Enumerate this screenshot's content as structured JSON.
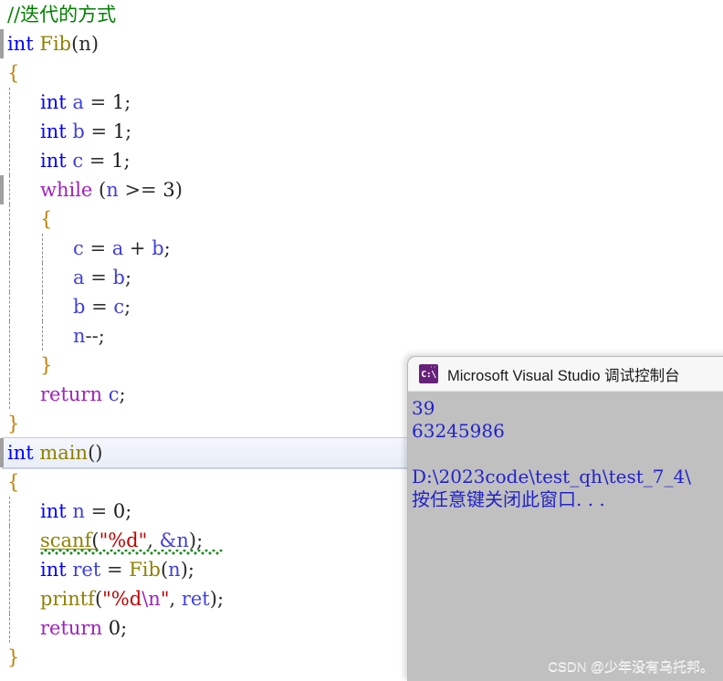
{
  "editor": {
    "name": "visual-studio-code-editor",
    "line_height": 32,
    "lines": [
      {
        "indent": 0,
        "changebar": false,
        "guides": 0,
        "tokens": [
          {
            "t": "//迭代的方式",
            "c": "cmt"
          }
        ]
      },
      {
        "indent": 0,
        "changebar": true,
        "guides": 0,
        "tokens": [
          {
            "t": "int",
            "c": "kw"
          },
          {
            "t": " ",
            "c": "plain"
          },
          {
            "t": "Fib",
            "c": "fn"
          },
          {
            "t": "(n)",
            "c": "punct"
          }
        ]
      },
      {
        "indent": 0,
        "changebar": false,
        "guides": 0,
        "tokens": [
          {
            "t": "{",
            "c": "brace"
          }
        ]
      },
      {
        "indent": 1,
        "changebar": false,
        "guides": 1,
        "tokens": [
          {
            "t": "int",
            "c": "kw"
          },
          {
            "t": " ",
            "c": "plain"
          },
          {
            "t": "a",
            "c": "var"
          },
          {
            "t": " = ",
            "c": "plain"
          },
          {
            "t": "1",
            "c": "num"
          },
          {
            "t": ";",
            "c": "punct"
          }
        ]
      },
      {
        "indent": 1,
        "changebar": false,
        "guides": 1,
        "tokens": [
          {
            "t": "int",
            "c": "kw"
          },
          {
            "t": " ",
            "c": "plain"
          },
          {
            "t": "b",
            "c": "var"
          },
          {
            "t": " = ",
            "c": "plain"
          },
          {
            "t": "1",
            "c": "num"
          },
          {
            "t": ";",
            "c": "punct"
          }
        ]
      },
      {
        "indent": 1,
        "changebar": false,
        "guides": 1,
        "tokens": [
          {
            "t": "int",
            "c": "kw"
          },
          {
            "t": " ",
            "c": "plain"
          },
          {
            "t": "c",
            "c": "var"
          },
          {
            "t": " = ",
            "c": "plain"
          },
          {
            "t": "1",
            "c": "num"
          },
          {
            "t": ";",
            "c": "punct"
          }
        ]
      },
      {
        "indent": 1,
        "changebar": true,
        "guides": 1,
        "tokens": [
          {
            "t": "while",
            "c": "kwc"
          },
          {
            "t": " (",
            "c": "punct"
          },
          {
            "t": "n",
            "c": "var"
          },
          {
            "t": " >= ",
            "c": "plain"
          },
          {
            "t": "3",
            "c": "num"
          },
          {
            "t": ")",
            "c": "punct"
          }
        ]
      },
      {
        "indent": 1,
        "changebar": false,
        "guides": 1,
        "tokens": [
          {
            "t": "{",
            "c": "brace"
          }
        ]
      },
      {
        "indent": 2,
        "changebar": false,
        "guides": 2,
        "tokens": [
          {
            "t": "c",
            "c": "var"
          },
          {
            "t": " = ",
            "c": "plain"
          },
          {
            "t": "a",
            "c": "var"
          },
          {
            "t": " + ",
            "c": "plain"
          },
          {
            "t": "b",
            "c": "var"
          },
          {
            "t": ";",
            "c": "punct"
          }
        ]
      },
      {
        "indent": 2,
        "changebar": false,
        "guides": 2,
        "tokens": [
          {
            "t": "a",
            "c": "var"
          },
          {
            "t": " = ",
            "c": "plain"
          },
          {
            "t": "b",
            "c": "var"
          },
          {
            "t": ";",
            "c": "punct"
          }
        ]
      },
      {
        "indent": 2,
        "changebar": false,
        "guides": 2,
        "tokens": [
          {
            "t": "b",
            "c": "var"
          },
          {
            "t": " = ",
            "c": "plain"
          },
          {
            "t": "c",
            "c": "var"
          },
          {
            "t": ";",
            "c": "punct"
          }
        ]
      },
      {
        "indent": 2,
        "changebar": false,
        "guides": 2,
        "tokens": [
          {
            "t": "n",
            "c": "var"
          },
          {
            "t": "--;",
            "c": "plain"
          }
        ]
      },
      {
        "indent": 1,
        "changebar": false,
        "guides": 1,
        "tokens": [
          {
            "t": "}",
            "c": "brace"
          }
        ]
      },
      {
        "indent": 1,
        "changebar": false,
        "guides": 1,
        "tokens": [
          {
            "t": "return",
            "c": "kwc"
          },
          {
            "t": " ",
            "c": "plain"
          },
          {
            "t": "c",
            "c": "var"
          },
          {
            "t": ";",
            "c": "punct"
          }
        ]
      },
      {
        "indent": 0,
        "changebar": false,
        "guides": 0,
        "tokens": [
          {
            "t": "}",
            "c": "brace"
          }
        ]
      },
      {
        "indent": 0,
        "changebar": true,
        "guides": 0,
        "current": true,
        "tokens": [
          {
            "t": "int",
            "c": "kw"
          },
          {
            "t": " ",
            "c": "plain"
          },
          {
            "t": "main",
            "c": "fn"
          },
          {
            "t": "()",
            "c": "punct"
          }
        ]
      },
      {
        "indent": 0,
        "changebar": false,
        "guides": 0,
        "tokens": [
          {
            "t": "{",
            "c": "brace"
          }
        ]
      },
      {
        "indent": 1,
        "changebar": false,
        "guides": 1,
        "tokens": [
          {
            "t": "int",
            "c": "kw"
          },
          {
            "t": " ",
            "c": "plain"
          },
          {
            "t": "n",
            "c": "var"
          },
          {
            "t": " = ",
            "c": "plain"
          },
          {
            "t": "0",
            "c": "num"
          },
          {
            "t": ";",
            "c": "punct"
          }
        ]
      },
      {
        "indent": 1,
        "changebar": false,
        "guides": 1,
        "squiggle": true,
        "tokens": [
          {
            "t": "scanf",
            "c": "fn"
          },
          {
            "t": "(",
            "c": "punct"
          },
          {
            "t": "\"%d\"",
            "c": "str"
          },
          {
            "t": ", ",
            "c": "plain"
          },
          {
            "t": "&n",
            "c": "var"
          },
          {
            "t": ")",
            "c": "punct"
          },
          {
            "t": ";",
            "c": "punct"
          }
        ]
      },
      {
        "indent": 1,
        "changebar": false,
        "guides": 1,
        "tokens": [
          {
            "t": "int",
            "c": "kw"
          },
          {
            "t": " ",
            "c": "plain"
          },
          {
            "t": "ret",
            "c": "var"
          },
          {
            "t": " = ",
            "c": "plain"
          },
          {
            "t": "Fib",
            "c": "fn"
          },
          {
            "t": "(",
            "c": "punct"
          },
          {
            "t": "n",
            "c": "var"
          },
          {
            "t": ")",
            "c": "punct"
          },
          {
            "t": ";",
            "c": "punct"
          }
        ]
      },
      {
        "indent": 1,
        "changebar": false,
        "guides": 1,
        "tokens": [
          {
            "t": "printf",
            "c": "fn"
          },
          {
            "t": "(",
            "c": "punct"
          },
          {
            "t": "\"%d",
            "c": "str"
          },
          {
            "t": "\\n",
            "c": "esc"
          },
          {
            "t": "\"",
            "c": "str"
          },
          {
            "t": ", ",
            "c": "plain"
          },
          {
            "t": "ret",
            "c": "var"
          },
          {
            "t": ")",
            "c": "punct"
          },
          {
            "t": ";",
            "c": "punct"
          }
        ]
      },
      {
        "indent": 1,
        "changebar": false,
        "guides": 1,
        "tokens": [
          {
            "t": "return",
            "c": "kwc"
          },
          {
            "t": " ",
            "c": "plain"
          },
          {
            "t": "0",
            "c": "num"
          },
          {
            "t": ";",
            "c": "punct"
          }
        ]
      },
      {
        "indent": 0,
        "changebar": false,
        "guides": 0,
        "tokens": [
          {
            "t": "}",
            "c": "brace"
          }
        ]
      }
    ]
  },
  "console": {
    "icon": "command-prompt-icon",
    "icon_glyph": "C:\\",
    "title": "Microsoft Visual Studio 调试控制台",
    "lines": [
      "39",
      "63245986",
      "",
      "D:\\2023code\\test_qh\\test_7_4\\",
      "按任意键关闭此窗口. . ."
    ],
    "text_color": "#2222cc",
    "background_color": "#c0c0c0"
  },
  "watermark": {
    "text": "CSDN @少年没有乌托邦。"
  }
}
